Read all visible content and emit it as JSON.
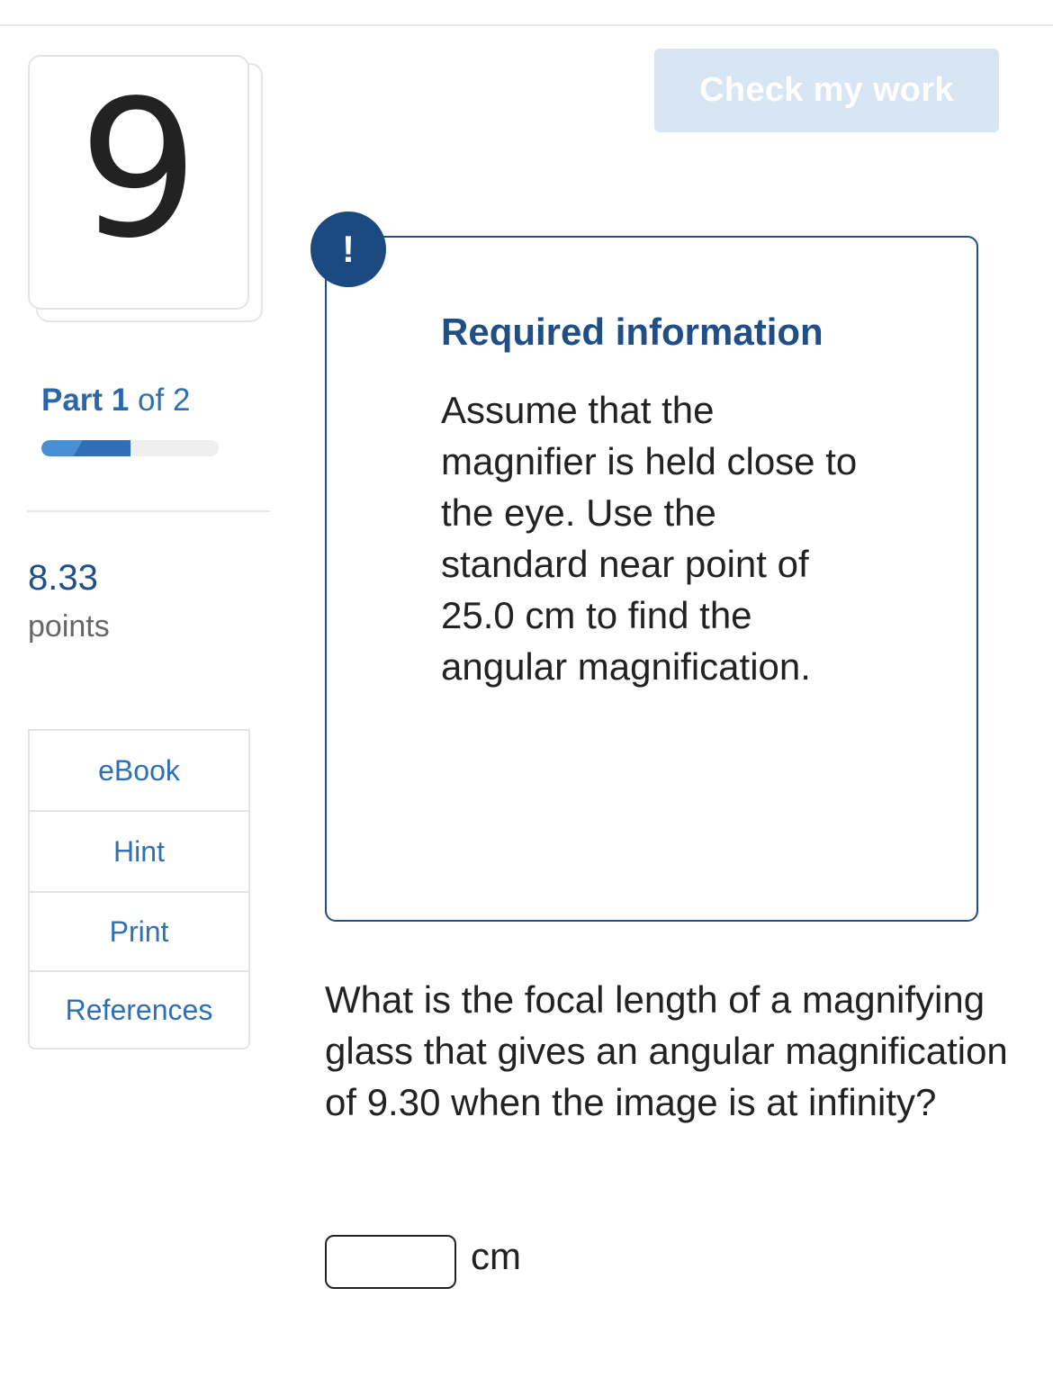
{
  "question": {
    "number": "9",
    "part_word": "Part",
    "part_current": "1",
    "part_of": "of 2",
    "progress_fraction": 0.5,
    "points_value": "8.33",
    "points_label": "points"
  },
  "tools": [
    {
      "label": "eBook"
    },
    {
      "label": "Hint"
    },
    {
      "label": "Print"
    },
    {
      "label": "References"
    }
  ],
  "toolbar": {
    "check_label": "Check my work"
  },
  "required": {
    "alert_symbol": "!",
    "title": "Required information",
    "text": "Assume that the magnifier is held close to the eye. Use the standard near point of 25.0 cm to find the angular magnification."
  },
  "prompt": {
    "text": "What is the focal length of a magnifying glass that gives an angular magnification of 9.30 when the image is at infinity?",
    "answer_value": "",
    "unit": "cm"
  },
  "colors": {
    "accent": "#2f6fb2",
    "dark_accent": "#1f4f86",
    "button_disabled_bg": "#d8e5f3"
  }
}
